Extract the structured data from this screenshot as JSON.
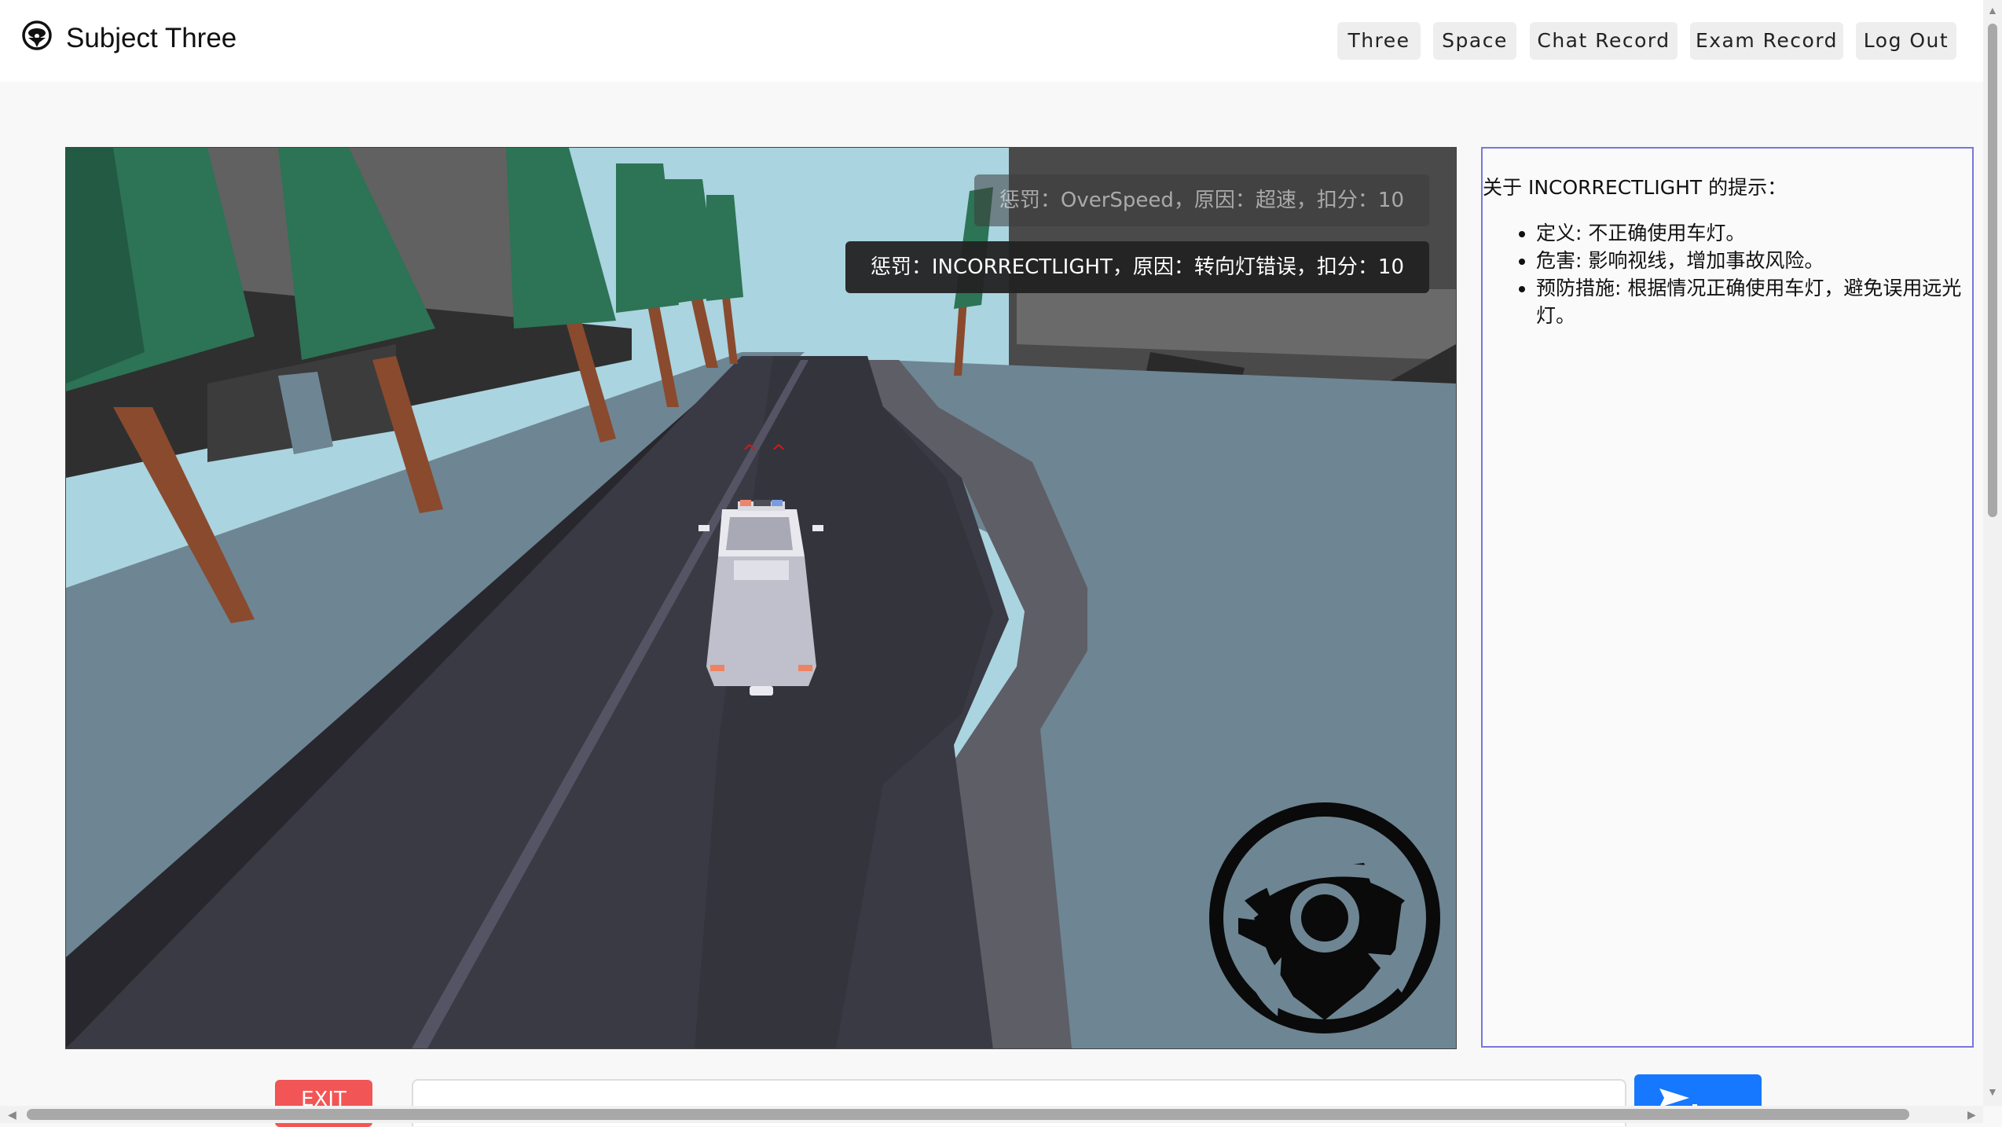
{
  "header": {
    "title": "Subject Three",
    "nav": [
      {
        "label": "Three"
      },
      {
        "label": "Space"
      },
      {
        "label": "Chat Record"
      },
      {
        "label": "Exam Record"
      },
      {
        "label": "Log Out"
      }
    ]
  },
  "game": {
    "penalties": [
      "惩罚：OverSpeed，原因：超速，扣分：10",
      "惩罚：INCORRECTLIGHT，原因：转向灯错误，扣分：10"
    ]
  },
  "hint": {
    "title": "关于 INCORRECTLIGHT 的提示：",
    "items": [
      "定义: 不正确使用车灯。",
      "危害: 影响视线，增加事故风险。",
      "预防措施: 根据情况正确使用车灯，避免误用远光灯。"
    ]
  },
  "controls": {
    "exit_label": "EXIT",
    "input_value": "",
    "send_icon": "send-icon"
  },
  "colors": {
    "accent": "#1677ff",
    "exit": "#f25555",
    "panel_border": "#7777dd"
  }
}
